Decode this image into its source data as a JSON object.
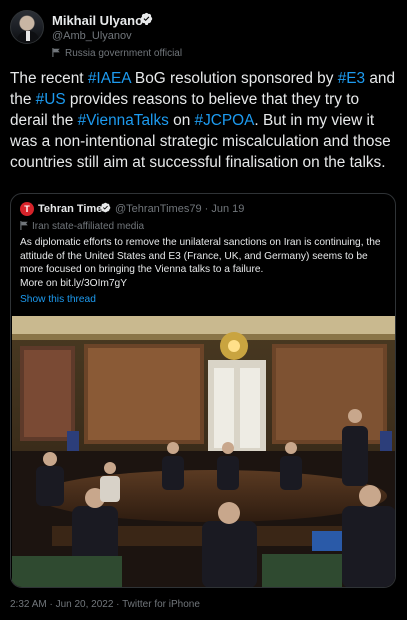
{
  "author": {
    "name": "Mikhail Ulyanov",
    "handle": "@Amb_Ulyanov",
    "label": "Russia government official"
  },
  "tweet": {
    "p1": "The recent ",
    "t1": "#IAEA",
    "p2": " BoG resolution sponsored by ",
    "t2": "#E3",
    "p3": " and the ",
    "t3": "#US",
    "p4": " provides reasons to believe that they try to derail the ",
    "t4": "#ViennaTalks",
    "p5": " on ",
    "t5": "#JCPOA",
    "p6": ". But in my view it was a non-intentional strategic miscalculation and those countries still aim at successful finalisation on the talks."
  },
  "quoted": {
    "logo_letter": "T",
    "name": "Tehran Times",
    "handle_date": "@TehranTimes79 · Jun 19",
    "label": "Iran state-affiliated media",
    "text": "As diplomatic efforts to remove the unilateral sanctions on Iran is continuing, the attitude of the United States and E3 (France, UK, and Germany) seems to be more focused on bringing the Vienna talks to a failure.",
    "more": "More on bit.ly/3OIm7gY",
    "show_thread": "Show this thread"
  },
  "footer": {
    "meta": "2:32 AM · Jun 20, 2022 · Twitter for iPhone"
  },
  "colors": {
    "accent": "#1d9bf0",
    "text": "#e7e9ea",
    "muted": "#71767b",
    "background": "#000000"
  }
}
